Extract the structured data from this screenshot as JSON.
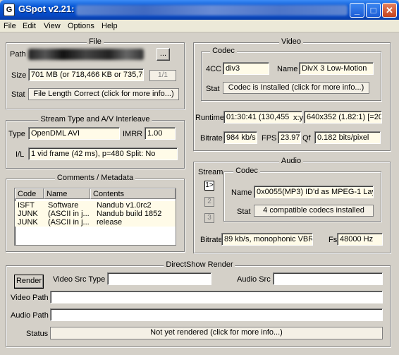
{
  "window": {
    "title": "GSpot v2.21:",
    "icon": "gspot-app-icon",
    "buttons": {
      "minimize": "_",
      "maximize": "□",
      "close": "✕"
    }
  },
  "menu": [
    "File",
    "Edit",
    "View",
    "Options",
    "Help"
  ],
  "file_group": {
    "title": "File",
    "path_label": "Path",
    "browse_label": "...",
    "size_label": "Size",
    "size_value": "701 MB (or 718,466 KB or 735,70",
    "part_counter": "1/1",
    "stat_label": "Stat",
    "stat_button": "File Length Correct (click for more info...)"
  },
  "stream_group": {
    "title": "Stream Type and A/V Interleave",
    "type_label": "Type",
    "type_value": "OpenDML AVI",
    "imrr_label": "IMRR",
    "imrr_value": "1.00",
    "il_label": "I/L",
    "il_value": "1 vid frame (42 ms), p=480  Split: No"
  },
  "comments_group": {
    "title": "Comments / Metadata",
    "columns": [
      "Code",
      "Name",
      "Contents"
    ],
    "rows": [
      [
        "ISFT",
        "Software",
        "Nandub v1.0rc2"
      ],
      [
        "JUNK",
        "(ASCII in j...",
        "Nandub build 1852"
      ],
      [
        "JUNK",
        "(ASCII in j...",
        "release"
      ]
    ]
  },
  "video_group": {
    "title": "Video",
    "codec_title": "Codec",
    "fourcc_label": "4CC",
    "fourcc_value": "div3",
    "name_label": "Name",
    "name_value": "DivX 3 Low-Motion",
    "stat_label": "Stat",
    "stat_button": "Codec is Installed (click for more info...)",
    "runtime_label": "Runtime",
    "runtime_value": "01:30:41 (130,455",
    "xy_label": "x:y",
    "xy_value": "640x352 (1.82:1) [=20",
    "bitrate_label": "Bitrate",
    "bitrate_value": "984 kb/s",
    "fps_label": "FPS",
    "fps_value": "23.97",
    "qf_label": "Qf",
    "qf_value": "0.182 bits/pixel"
  },
  "audio_group": {
    "title": "Audio",
    "stream_label": "Stream",
    "streams": [
      "1>",
      "2",
      "3"
    ],
    "codec_title": "Codec",
    "name_label": "Name",
    "name_value": "0x0055(MP3) ID'd as MPEG-1 Lay",
    "stat_label": "Stat",
    "stat_button": "4 compatible codecs installed",
    "bitrate_label": "Bitrate",
    "bitrate_value": "89 kb/s, monophonic VBR",
    "fs_label": "Fs",
    "fs_value": "48000 Hz"
  },
  "directshow_group": {
    "title": "DirectShow Render",
    "render_button": "Render",
    "video_src_label": "Video Src Type",
    "video_src_value": "",
    "audio_src_label": "Audio Src",
    "audio_src_value": "",
    "video_path_label": "Video Path",
    "video_path_value": "",
    "audio_path_label": "Audio Path",
    "audio_path_value": "",
    "status_label": "Status",
    "status_button": "Not yet rendered (click for more info...)"
  }
}
